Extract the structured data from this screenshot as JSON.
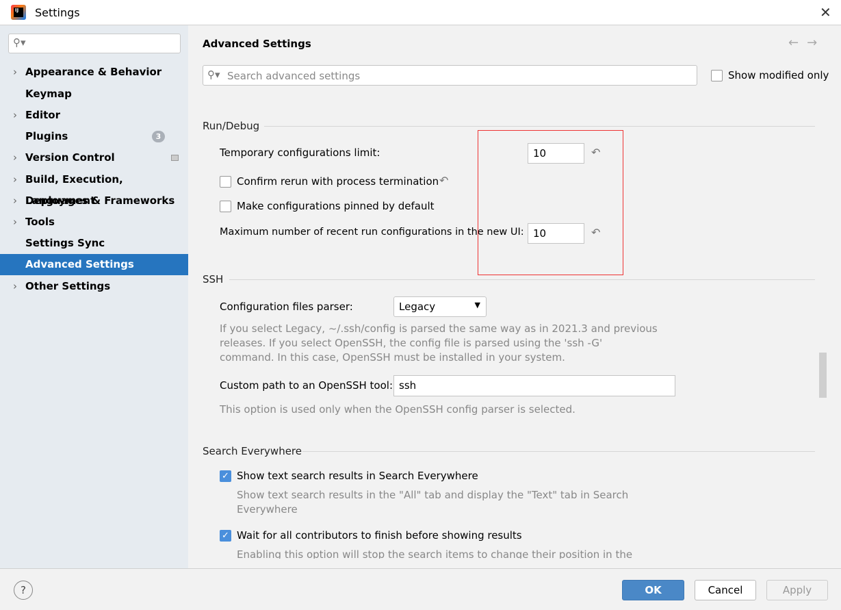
{
  "window": {
    "title": "Settings"
  },
  "sidebar": {
    "items": [
      {
        "label": "Appearance & Behavior",
        "expandable": true
      },
      {
        "label": "Keymap",
        "expandable": false
      },
      {
        "label": "Editor",
        "expandable": true
      },
      {
        "label": "Plugins",
        "expandable": false,
        "badge": "3"
      },
      {
        "label": "Version Control",
        "expandable": true
      },
      {
        "label": "Build, Execution, Deployment",
        "expandable": true
      },
      {
        "label": "Languages & Frameworks",
        "expandable": true
      },
      {
        "label": "Tools",
        "expandable": true
      },
      {
        "label": "Settings Sync",
        "expandable": false
      },
      {
        "label": "Advanced Settings",
        "expandable": false,
        "selected": true
      },
      {
        "label": "Other Settings",
        "expandable": true
      }
    ]
  },
  "main": {
    "title": "Advanced Settings",
    "search_placeholder": "Search advanced settings",
    "show_modified_label": "Show modified only",
    "run_debug": {
      "header": "Run/Debug",
      "temp_limit_label": "Temporary configurations limit:",
      "temp_limit_value": "10",
      "confirm_rerun_label": "Confirm rerun with process termination",
      "pinned_label": "Make configurations pinned by default",
      "max_recent_label": "Maximum number of recent run configurations in the new UI:",
      "max_recent_value": "10"
    },
    "ssh": {
      "header": "SSH",
      "parser_label": "Configuration files parser:",
      "parser_value": "Legacy",
      "parser_hint1": "If you select Legacy, ~/.ssh/config is parsed the same way as in 2021.3 and previous",
      "parser_hint2": "releases. If you select OpenSSH, the config file is parsed using the 'ssh -G'",
      "parser_hint3": "command. In this case, OpenSSH must be installed in your system.",
      "path_label": "Custom path to an OpenSSH tool:",
      "path_value": "ssh",
      "path_hint": "This option is used only when the OpenSSH config parser is selected."
    },
    "search_everywhere": {
      "header": "Search Everywhere",
      "text_search_label": "Show text search results in Search Everywhere",
      "text_search_hint1": "Show text search results in the \"All\" tab and display the \"Text\" tab in Search",
      "text_search_hint2": "Everywhere",
      "wait_label": "Wait for all contributors to finish before showing results",
      "wait_hint": "Enabling this option will stop the search items to change their position in the"
    }
  },
  "footer": {
    "help": "?",
    "ok": "OK",
    "cancel": "Cancel",
    "apply": "Apply"
  },
  "colors": {
    "accent": "#2675bf",
    "ok_button": "#4a88c7",
    "highlight_box": "#e33333"
  }
}
